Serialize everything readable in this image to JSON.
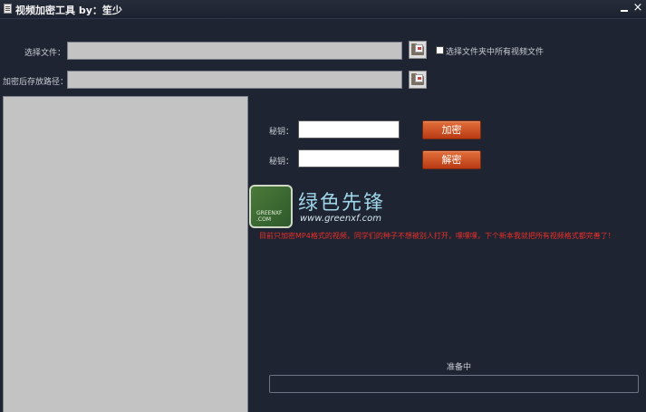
{
  "window": {
    "title": "视频加密工具 by：笙少",
    "minimize_icon": "minimize-icon",
    "close_icon": "close-icon",
    "close_glyph": "×"
  },
  "file_select": {
    "label": "选择文件：",
    "value": "",
    "browse_icon": "folder-icon",
    "checkbox_label": "选择文件夹中所有视频文件",
    "checkbox_checked": false
  },
  "output_path": {
    "label": "加密后存放路径：",
    "value": "",
    "browse_icon": "folder-icon"
  },
  "file_list": {
    "items": []
  },
  "key1": {
    "label": "秘钥：",
    "value": ""
  },
  "key2": {
    "label": "秘钥：",
    "value": ""
  },
  "buttons": {
    "encrypt": "加密",
    "decrypt": "解密"
  },
  "watermark": {
    "cn": "绿色先锋",
    "url": "www.greenxf.com",
    "logo_text": "GREENXF\n.COM"
  },
  "notice": "目前只加密MP4格式的视频，同学们的种子不想被别人打开，嘿嘿嘿，下个新本我就把所有视频格式都完善了！",
  "status": {
    "text": "准备中",
    "progress": 0
  },
  "colors": {
    "background": "#1e2432",
    "button": "#d0552a",
    "notice": "#e8302a"
  }
}
